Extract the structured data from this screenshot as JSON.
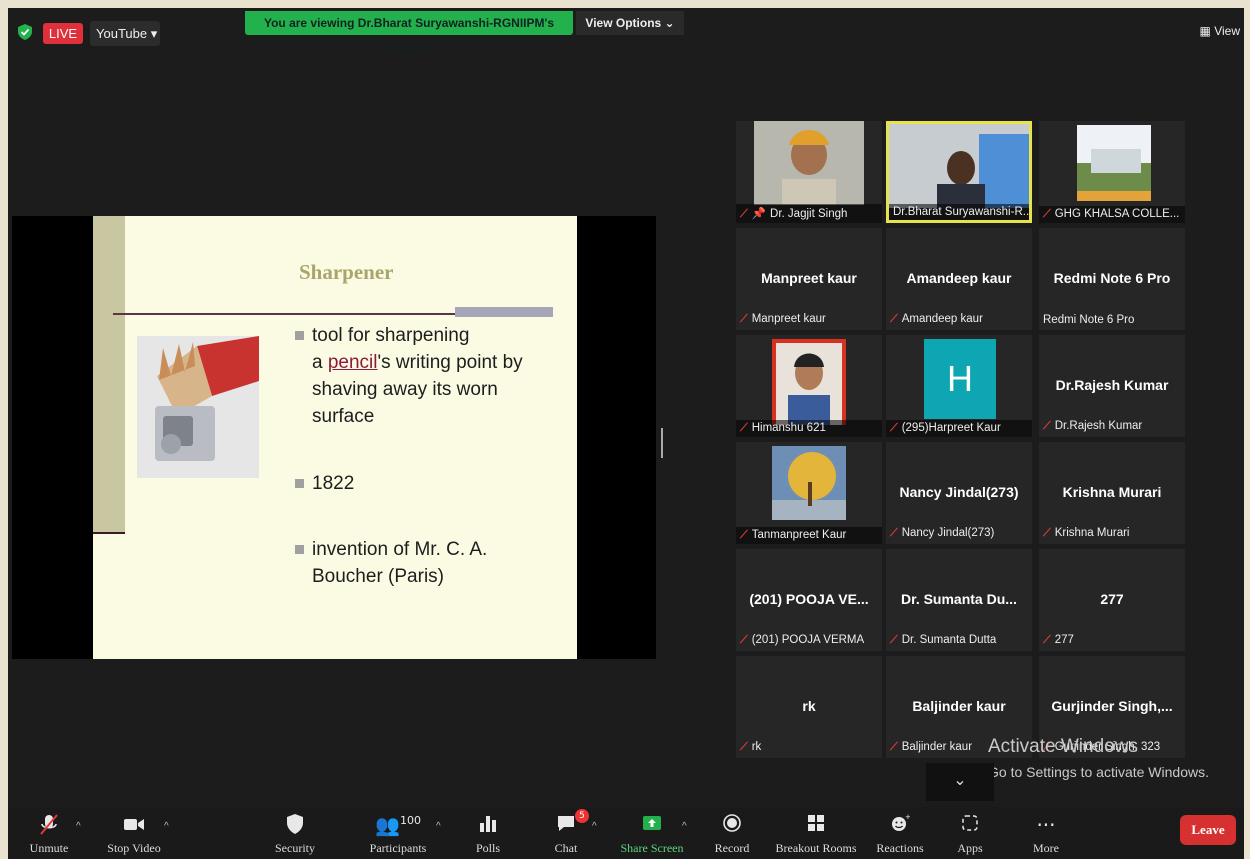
{
  "topbar": {
    "live_label": "LIVE",
    "youtube_label": "YouTube ▾",
    "viewing_text": "You are viewing Dr.Bharat Suryawanshi-RGNIIPM's screen",
    "view_options_label": "View Options ⌄",
    "view_label": "View"
  },
  "slide": {
    "title": "Sharpener",
    "bullet1_a": "tool for sharpening",
    "bullet1_b_pre": "a ",
    "bullet1_b_link": "pencil",
    "bullet1_b_post": "'s writing point by",
    "bullet1_c": "shaving away its worn",
    "bullet1_d": "surface",
    "bullet2": "1822",
    "bullet3_a": "invention of Mr. C. A.",
    "bullet3_b": "Boucher (Paris)"
  },
  "participants": [
    {
      "big": "",
      "name": "Dr. Jagjit Singh"
    },
    {
      "big": "",
      "name": "Dr.Bharat Suryawanshi-R..."
    },
    {
      "big": "",
      "name": "GHG KHALSA COLLE..."
    },
    {
      "big": "Manpreet kaur",
      "name": "Manpreet kaur"
    },
    {
      "big": "Amandeep kaur",
      "name": "Amandeep kaur"
    },
    {
      "big": "Redmi Note 6 Pro",
      "name": "Redmi Note 6 Pro"
    },
    {
      "big": "",
      "name": "Himanshu 621"
    },
    {
      "big": "H",
      "name": "(295)Harpreet Kaur"
    },
    {
      "big": "Dr.Rajesh Kumar",
      "name": "Dr.Rajesh Kumar"
    },
    {
      "big": "",
      "name": "Tanmanpreet Kaur"
    },
    {
      "big": "Nancy Jindal(273)",
      "name": "Nancy Jindal(273)"
    },
    {
      "big": "Krishna Murari",
      "name": "Krishna Murari"
    },
    {
      "big": "(201) POOJA VE...",
      "name": "(201) POOJA VERMA"
    },
    {
      "big": "Dr. Sumanta Du...",
      "name": "Dr. Sumanta Dutta"
    },
    {
      "big": "277",
      "name": "277"
    },
    {
      "big": "rk",
      "name": "rk"
    },
    {
      "big": "Baljinder kaur",
      "name": "Baljinder kaur"
    },
    {
      "big": "Gurjinder  Singh,...",
      "name": "Gurjinder Singh, 323"
    }
  ],
  "watermark": {
    "line1": "Activate Windows",
    "line2": "Go to Settings to activate Windows."
  },
  "toolbar": {
    "unmute": "Unmute",
    "stop_video": "Stop Video",
    "security": "Security",
    "participants_count": "100",
    "participants": "Participants",
    "polls": "Polls",
    "chat_badge": "5",
    "chat": "Chat",
    "share_screen": "Share Screen",
    "record": "Record",
    "breakout": "Breakout Rooms",
    "reactions": "Reactions",
    "apps": "Apps",
    "more": "More",
    "leave": "Leave"
  },
  "colors": {
    "live_red": "#e0303a",
    "viewing_green": "#23b14d",
    "active_speaker": "#e7e34e",
    "leave_red": "#d63031"
  }
}
